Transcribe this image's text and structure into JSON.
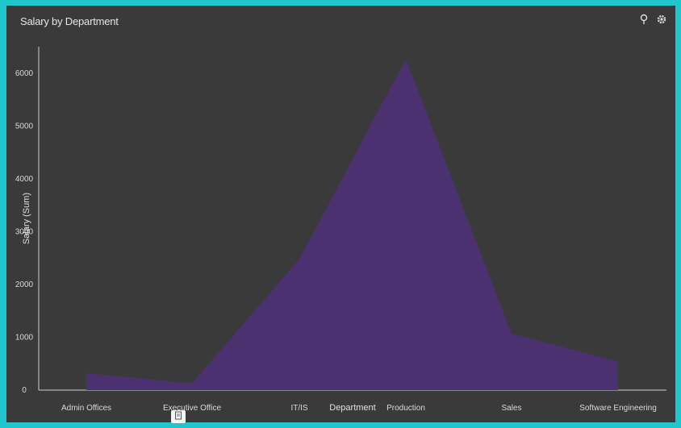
{
  "header": {
    "title": "Salary by Department"
  },
  "icons": [
    "pin-icon",
    "gear-icon",
    "copy-icon"
  ],
  "colors": {
    "frame": "#1fc6cc",
    "background": "#3a3a3a",
    "area_fill": "#4b3170",
    "text": "#d9d9d9"
  },
  "chart_data": {
    "type": "area",
    "title": "Salary by Department",
    "xlabel": "Department",
    "ylabel": "Salary (Sum)",
    "categories": [
      "Admin Offices",
      "Executive Office",
      "IT/IS",
      "Production",
      "Sales",
      "Software Engineering"
    ],
    "values": [
      320,
      130,
      2480,
      6270,
      1070,
      540
    ],
    "ylim": [
      0,
      6500
    ],
    "yticks": [
      0,
      1000,
      2000,
      3000,
      4000,
      5000,
      6000
    ],
    "ytick_labels": [
      "0",
      "1000",
      "2000",
      "3000",
      "4000",
      "5000",
      "6000"
    ],
    "grid": false,
    "legend": "none"
  }
}
